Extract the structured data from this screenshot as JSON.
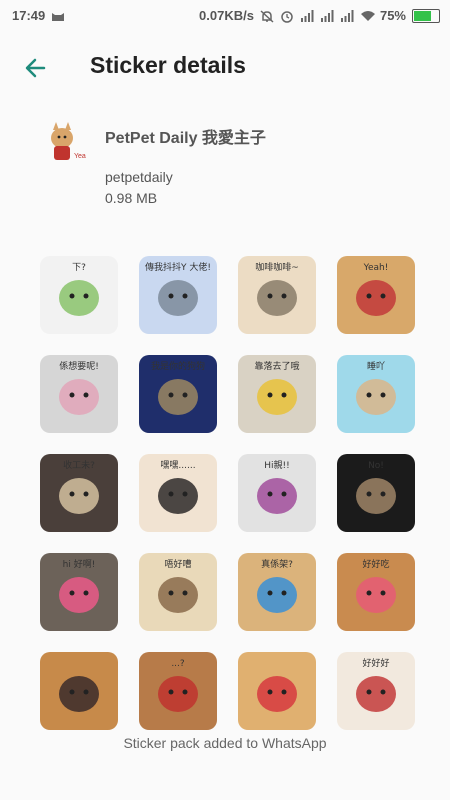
{
  "statusbar": {
    "time": "17:49",
    "speed": "0.07KB/s",
    "battery": "75%",
    "battery_level": 0.75
  },
  "header": {
    "title": "Sticker details"
  },
  "pack": {
    "name": "PetPet Daily 我愛主子",
    "publisher": "petpetdaily",
    "size": "0.98 MB"
  },
  "stickers": [
    {
      "text": "下?",
      "colors": [
        "#f2f2f2",
        "#89c36b"
      ]
    },
    {
      "text": "傳我抖抖Y 大佬!",
      "colors": [
        "#c9d8f0",
        "#7d8b9a"
      ]
    },
    {
      "text": "咖啡咖啡~",
      "colors": [
        "#ecdcc4",
        "#8a7d6a"
      ]
    },
    {
      "text": "Yeah!",
      "colors": [
        "#d8a86a",
        "#c23a3a"
      ]
    },
    {
      "text": "係想要呢!",
      "colors": [
        "#d6d6d6",
        "#e2a4b8"
      ]
    },
    {
      "text": "我是你的狗狗",
      "colors": [
        "#1f2e6b",
        "#9b8660"
      ]
    },
    {
      "text": "靠落去了哦",
      "colors": [
        "#d9d2c4",
        "#e7c23a"
      ]
    },
    {
      "text": "睡吖",
      "colors": [
        "#9fd9ea",
        "#d9b58a"
      ]
    },
    {
      "text": "收工未?",
      "colors": [
        "#4a3f3a",
        "#d3c1a0"
      ]
    },
    {
      "text": "嘿嘿......",
      "colors": [
        "#f1e3d2",
        "#2e2a2a"
      ]
    },
    {
      "text": "Hi親!!",
      "colors": [
        "#e2e2e2",
        "#a14d9b"
      ]
    },
    {
      "text": "No!",
      "colors": [
        "#1b1b1b",
        "#9d8466"
      ]
    },
    {
      "text": "hi 好啊!",
      "colors": [
        "#6c6259",
        "#ea5b88"
      ]
    },
    {
      "text": "唔好嘈",
      "colors": [
        "#e9d9b9",
        "#8a6a4a"
      ]
    },
    {
      "text": "真係架?",
      "colors": [
        "#dbb37b",
        "#3a8fd6"
      ]
    },
    {
      "text": "好好吃",
      "colors": [
        "#c98b4f",
        "#e65a76"
      ]
    },
    {
      "text": "",
      "colors": [
        "#c78a4a",
        "#3a2a2a"
      ]
    },
    {
      "text": "...?",
      "colors": [
        "#b77b49",
        "#c0342e"
      ]
    },
    {
      "text": "",
      "colors": [
        "#e0b070",
        "#d6393e"
      ]
    },
    {
      "text": "好好好",
      "colors": [
        "#f2e9de",
        "#c33b3b"
      ]
    }
  ],
  "footer": {
    "text": "Sticker pack added to WhatsApp"
  }
}
